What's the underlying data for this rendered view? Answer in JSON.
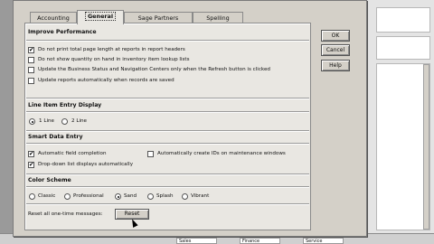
{
  "tabs": [
    {
      "label": "Accounting"
    },
    {
      "label": "General"
    },
    {
      "label": "Sage Partners"
    },
    {
      "label": "Spelling"
    }
  ],
  "improve_performance": {
    "title": "Improve Performance",
    "options": [
      {
        "label": "Do not print total page length at reports in report headers",
        "checked": true
      },
      {
        "label": "Do not show quantity on hand in inventory item lookup lists",
        "checked": false
      },
      {
        "label": "Update the Business Status and Navigation Centers only when the Refresh button is clicked",
        "checked": false
      },
      {
        "label": "Update reports automatically when records are saved",
        "checked": false
      }
    ]
  },
  "line_item_entry": {
    "title": "Line Item Entry Display",
    "options": [
      {
        "label": "1 Line",
        "selected": true
      },
      {
        "label": "2 Line",
        "selected": false
      }
    ]
  },
  "smart_data_entry": {
    "title": "Smart Data Entry",
    "options": [
      {
        "label": "Automatic field completion",
        "checked": true
      },
      {
        "label": "Drop-down list displays automatically",
        "checked": true
      },
      {
        "label": "Automatically create IDs on maintenance windows",
        "checked": false
      }
    ]
  },
  "color_scheme": {
    "title": "Color Scheme",
    "options": [
      {
        "label": "Classic",
        "selected": false
      },
      {
        "label": "Professional",
        "selected": false
      },
      {
        "label": "Sand",
        "selected": true
      },
      {
        "label": "Splash",
        "selected": false
      },
      {
        "label": "Vibrant",
        "selected": false
      }
    ]
  },
  "reset": {
    "label": "Reset all one-time messages:",
    "button": "Reset"
  },
  "buttons": {
    "ok": "OK",
    "cancel": "Cancel",
    "help": "Help"
  },
  "background": {
    "columns": [
      "Sales",
      "Finance",
      "Service"
    ]
  }
}
